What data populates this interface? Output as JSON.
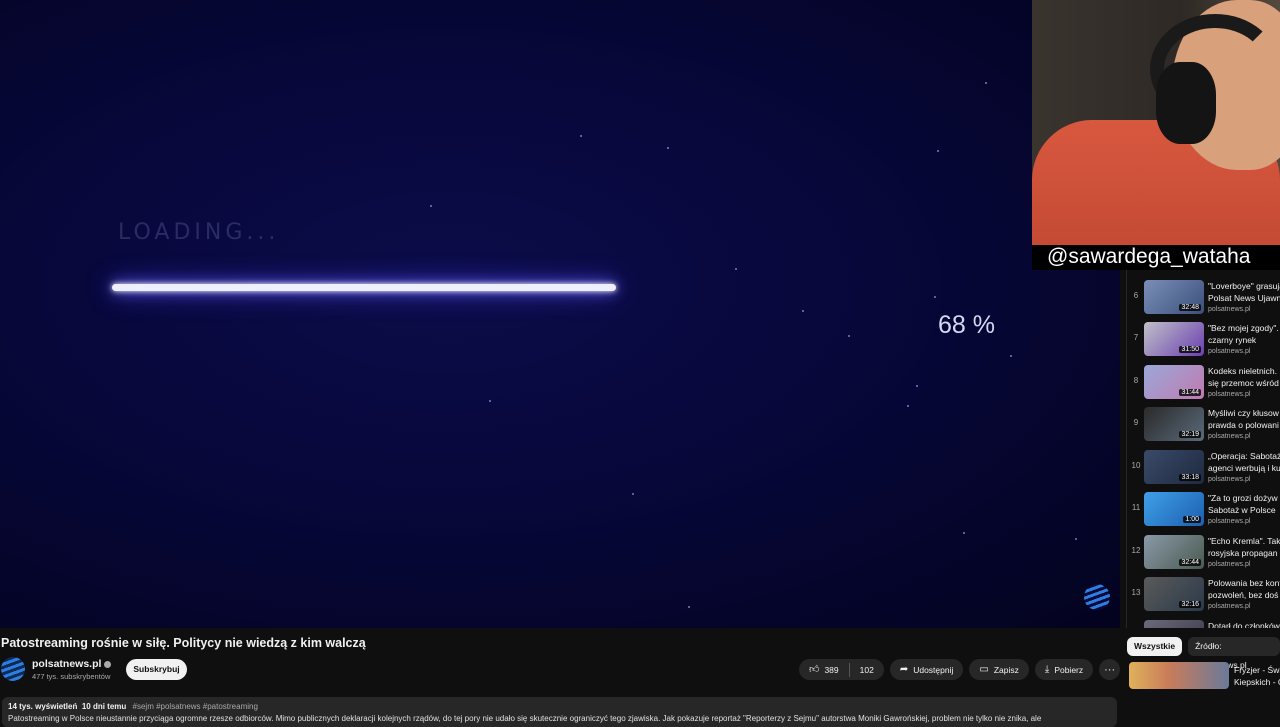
{
  "player": {
    "loading_text": "LOADING...",
    "percent_text": "68 %",
    "progress": 0.68
  },
  "webcam": {
    "handle": "@sawardega_wataha"
  },
  "playlist": {
    "items": [
      {
        "num": "6",
        "title": "\"Loverboye\" grasują",
        "title2": "Polsat News Ujawnia",
        "duration": "32:48",
        "channel": "polsatnews.pl"
      },
      {
        "num": "7",
        "title": "\"Bez mojej zgody\".",
        "title2": "czarny rynek",
        "duration": "31:50",
        "channel": "polsatnews.pl"
      },
      {
        "num": "8",
        "title": "Kodeks nieletnich.",
        "title2": "się przemoc wśród",
        "duration": "31:44",
        "channel": "polsatnews.pl"
      },
      {
        "num": "9",
        "title": "Myśliwi czy kłusow",
        "title2": "prawda o polowani",
        "duration": "32:19",
        "channel": "polsatnews.pl"
      },
      {
        "num": "10",
        "title": "„Operacja: Sabotaż",
        "title2": "agenci werbują i ku",
        "duration": "33:18",
        "channel": "polsatnews.pl"
      },
      {
        "num": "11",
        "title": "\"Za to grozi dożyw",
        "title2": "Sabotaż w Polsce",
        "duration": "1:00",
        "channel": "polsatnews.pl"
      },
      {
        "num": "12",
        "title": "\"Echo Kremla\". Tak",
        "title2": "rosyjska propagan",
        "duration": "32:44",
        "channel": "polsatnews.pl"
      },
      {
        "num": "13",
        "title": "Polowania bez kont",
        "title2": "pozwoleń, bez doś",
        "duration": "32:16",
        "channel": "polsatnews.pl"
      },
      {
        "num": "",
        "title": "Dotarł do członków",
        "title2": "",
        "duration": "",
        "channel": ""
      }
    ]
  },
  "video": {
    "title": "Patostreaming rośnie w siłę. Politycy nie wiedzą z kim walczą",
    "channel_name": "polsatnews.pl",
    "subscribers": "477 tys. subskrybentów",
    "subscribe_label": "Subskrybuj",
    "likes": "389",
    "dislikes": "102",
    "share_label": "Udostępnij",
    "save_label": "Zapisz",
    "download_label": "Pobierz",
    "more_label": "···"
  },
  "description": {
    "views": "14 tys. wyświetleń",
    "date": "10 dni temu",
    "tags": "#sejm #polsatnews #patostreaming",
    "text": "Patostreaming w Polsce nieustannie przyciąga ogromne rzesze odbiorców. Mimo publicznych deklaracji kolejnych rządów, do tej pory nie udało się skutecznie ograniczyć tego zjawiska. Jak pokazuje reportaż \"Reporterzy z Sejmu\" autorstwa Moniki Gawrońskiej, problem nie tylko nie znika, ale"
  },
  "chips": {
    "all": "Wszystkie",
    "source": "Źródło: polsatnews.pl"
  },
  "recommendation": {
    "title": "Fryzjer - Świ",
    "title2": "Kiepskich - C"
  },
  "colors": {
    "accent_glow": "#6f6cff",
    "background": "#0f0f0f",
    "pill": "#272727"
  }
}
